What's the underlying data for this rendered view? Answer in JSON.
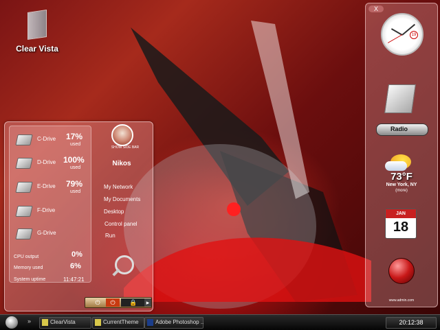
{
  "desktop": {
    "icons": [
      {
        "label": "Clear Vista",
        "icon": "folder-icon"
      }
    ]
  },
  "system_panel": {
    "sidebar_toggle": "SHOW SIDE BAR",
    "username": "Nikos",
    "drives": [
      {
        "name": "C-Drive",
        "percent": "17%",
        "used_label": "used"
      },
      {
        "name": "D-Drive",
        "percent": "100%",
        "used_label": "used"
      },
      {
        "name": "E-Drive",
        "percent": "79%",
        "used_label": "used"
      },
      {
        "name": "F-Drive"
      },
      {
        "name": "G-Drive"
      }
    ],
    "stats": {
      "cpu_label": "CPU output",
      "cpu_value": "0%",
      "memory_label": "Memory used",
      "memory_value": "6%",
      "uptime_label": "System uptime",
      "uptime_value": "11:47:21"
    },
    "menu": [
      "My Network",
      "My Documents",
      "Desktop",
      "Control panel",
      "Run"
    ],
    "power_icons": [
      "power-icon",
      "power-icon",
      "lock-icon",
      "arrow-right-icon"
    ]
  },
  "sidebar": {
    "close_label": "X",
    "clock_date": "19",
    "radio_label": "Radio",
    "weather": {
      "temp": "73°F",
      "location": "New York, NY",
      "more": "(more)"
    },
    "calendar": {
      "month": "JAN",
      "day": "18"
    },
    "footer": "www.admin.com"
  },
  "taskbar": {
    "chevron": "»",
    "tasks": [
      {
        "label": "ClearVista",
        "icon": "folder-icon"
      },
      {
        "label": "CurrentTheme",
        "icon": "folder-icon"
      },
      {
        "label": "Adobe Photoshop ...",
        "icon": "photoshop-icon"
      }
    ],
    "clock": "20:12:38"
  },
  "colors": {
    "accent": "#c81818",
    "panel": "#ffc3c3",
    "taskbar": "#111111"
  }
}
